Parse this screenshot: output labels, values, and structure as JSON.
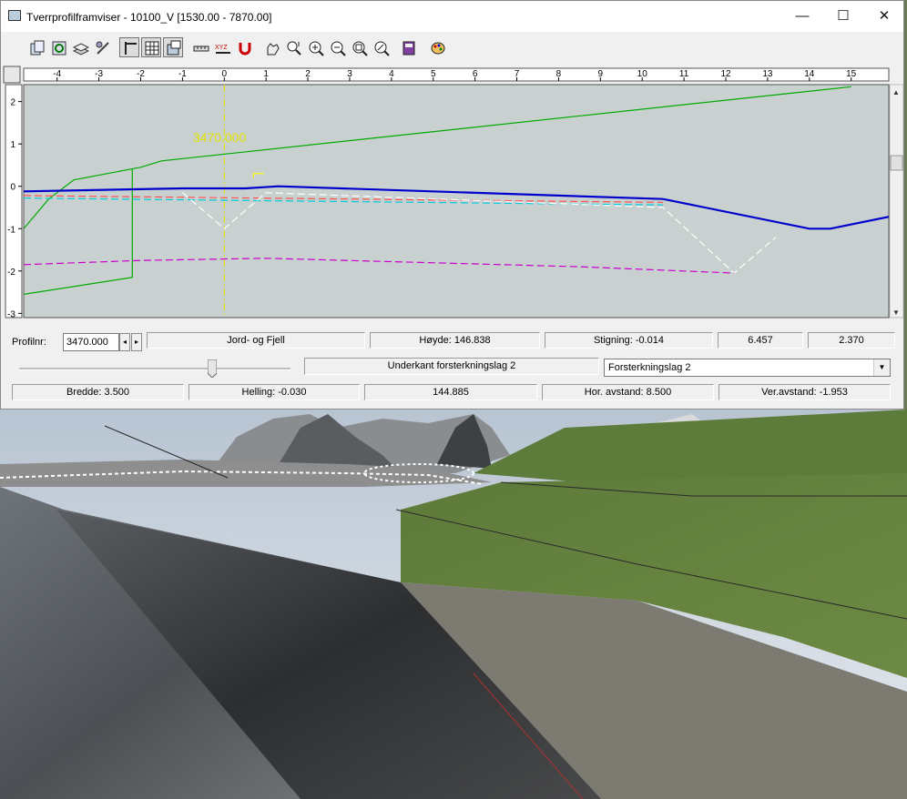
{
  "window": {
    "title": "Tverrprofilframviser - 10100_V  [1530.00 - 7870.00]",
    "minimize_glyph": "—",
    "maximize_glyph": "☐",
    "close_glyph": "✕"
  },
  "toolbar": {
    "buttons": [
      {
        "icon": "copy-icon"
      },
      {
        "icon": "refresh-icon"
      },
      {
        "icon": "layers-icon"
      },
      {
        "icon": "link-icon"
      },
      {
        "icon": "axis-icon",
        "pressed": true
      },
      {
        "icon": "grid-icon",
        "pressed": true
      },
      {
        "icon": "settings-view-icon",
        "pressed": true
      },
      {
        "icon": "measure-icon"
      },
      {
        "icon": "xyz-icon",
        "text": "XYZ"
      },
      {
        "icon": "magnet-icon"
      },
      {
        "icon": "pan-hand-icon"
      },
      {
        "icon": "zoom-vertical-icon"
      },
      {
        "icon": "zoom-in-icon"
      },
      {
        "icon": "zoom-out-icon"
      },
      {
        "icon": "zoom-window-icon"
      },
      {
        "icon": "zoom-all-icon"
      },
      {
        "icon": "book-icon"
      },
      {
        "icon": "palette-icon"
      }
    ]
  },
  "chart_data": {
    "type": "line",
    "title": "",
    "xlabel": "",
    "ylabel": "",
    "xlim": [
      -4.8,
      15.9
    ],
    "ylim": [
      -3.1,
      2.4
    ],
    "x_ticks": [
      -4,
      -3,
      -2,
      -1,
      0,
      1,
      2,
      3,
      4,
      5,
      6,
      7,
      8,
      9,
      10,
      11,
      12,
      13,
      14,
      15
    ],
    "y_ticks": [
      2,
      1,
      0,
      -1,
      -2,
      -3
    ],
    "grid": false,
    "background": "#c8d0d0",
    "annotation": {
      "text": "3470.000",
      "x": -0.75,
      "y": 1.05,
      "color": "#e0e000"
    },
    "center_line_x": 0,
    "series": [
      {
        "color": "#00aa00",
        "style": "solid",
        "x": [
          -4.8,
          -4.2,
          -3.6,
          -2.0,
          -1.5,
          15.0
        ],
        "y": [
          -1.0,
          -0.3,
          0.15,
          0.45,
          0.6,
          2.35
        ]
      },
      {
        "color": "#00aa00",
        "style": "solid",
        "x": [
          -4.8,
          -2.2,
          -2.2
        ],
        "y": [
          -2.55,
          -2.15,
          0.4
        ]
      },
      {
        "color": "#0000cc",
        "style": "solid",
        "width": 2.2,
        "x": [
          -4.8,
          -1.0,
          0.5,
          1.3,
          10.5,
          14.0,
          14.5,
          15.9
        ],
        "y": [
          -0.12,
          -0.05,
          -0.05,
          0.0,
          -0.3,
          -1.0,
          -1.0,
          -0.72
        ]
      },
      {
        "color": "#ff5050",
        "style": "dashed",
        "x": [
          -4.8,
          10.5
        ],
        "y": [
          -0.22,
          -0.38
        ]
      },
      {
        "color": "#00ccdd",
        "style": "dashed",
        "x": [
          -4.8,
          10.5
        ],
        "y": [
          -0.28,
          -0.44
        ]
      },
      {
        "color": "#ffffff",
        "style": "dashed",
        "x": [
          -1.0,
          0.0,
          1.0,
          10.5,
          12.2,
          13.2
        ],
        "y": [
          -0.15,
          -1.0,
          -0.15,
          -0.5,
          -2.05,
          -1.2
        ]
      },
      {
        "color": "#cc00cc",
        "style": "dashed",
        "x": [
          -4.8,
          -2.0,
          1.0,
          8.5,
          12.2
        ],
        "y": [
          -1.85,
          -1.75,
          -1.7,
          -1.9,
          -2.05
        ]
      },
      {
        "color": "#ffff00",
        "style": "solid",
        "x": [
          0.7,
          0.7,
          0.95
        ],
        "y": [
          0.2,
          0.3,
          0.3
        ]
      }
    ]
  },
  "status": {
    "profilnr_label": "Profilnr:",
    "profilnr_value": "3470.000",
    "spin_left": "◂",
    "spin_right": "▸",
    "material": "Jord- og Fjell",
    "hoyde": "Høyde: 146.838",
    "stigning": "Stigning: -0.014",
    "val1": "6.457",
    "val2": "2.370",
    "layer_name": "Underkant forsterkningslag 2",
    "layer_select": "Forsterkningslag 2",
    "slider_value": 0.71,
    "bredde": "Bredde: 3.500",
    "helling": "Helling: -0.030",
    "elevation": "144.885",
    "hor_avstand": "Hor. avstand: 8.500",
    "ver_avstand": "Ver.avstand: -1.953"
  }
}
